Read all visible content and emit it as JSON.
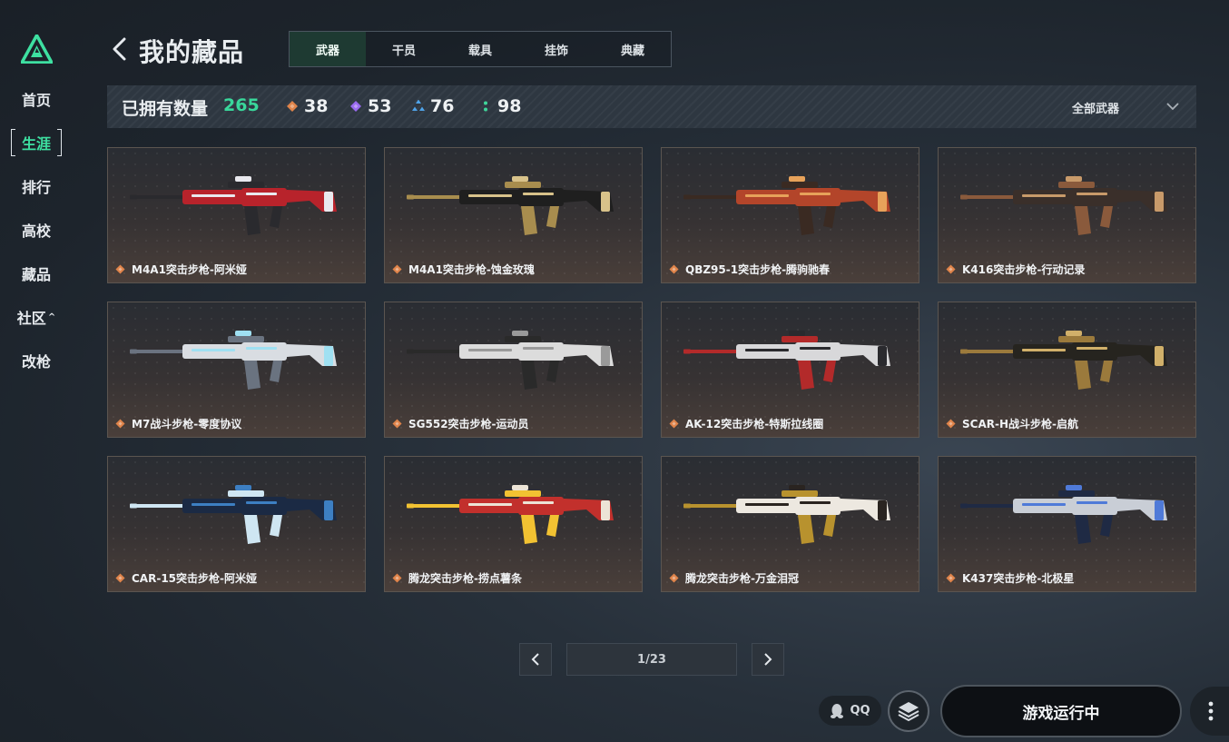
{
  "sidebar": {
    "nav": [
      {
        "label": "首页"
      },
      {
        "label": "生涯"
      },
      {
        "label": "排行"
      },
      {
        "label": "高校"
      },
      {
        "label": "藏品"
      },
      {
        "label": "社区"
      },
      {
        "label": "改枪"
      }
    ],
    "active_index": 1
  },
  "header": {
    "title": "我的藏品",
    "tabs": [
      {
        "label": "武器"
      },
      {
        "label": "干员"
      },
      {
        "label": "载具"
      },
      {
        "label": "挂饰"
      },
      {
        "label": "典藏"
      }
    ],
    "active_tab": 0
  },
  "stats": {
    "owned_label": "已拥有数量",
    "owned_count": "265",
    "rarities": [
      {
        "icon": "orange-diamond-icon",
        "color": "#e0844a",
        "count": "38"
      },
      {
        "icon": "purple-diamond-icon",
        "color": "#9a6bf0",
        "count": "53"
      },
      {
        "icon": "blue-triangle-icon",
        "color": "#4fa3e8",
        "count": "76"
      },
      {
        "icon": "green-dots-icon",
        "color": "#3fd69a",
        "count": "98"
      }
    ],
    "filter_label": "全部武器"
  },
  "grid": {
    "items": [
      {
        "name": "M4A1突击步枪-阿米娅",
        "rarity_color": "#e0844a",
        "palette": [
          "#b8232b",
          "#2a2a2e",
          "#e9e9ee"
        ]
      },
      {
        "name": "M4A1突击步枪-蚀金玫瑰",
        "rarity_color": "#e0844a",
        "palette": [
          "#1f1f1f",
          "#a88d4e",
          "#d8c28a"
        ]
      },
      {
        "name": "QBZ95-1突击步枪-腾驹驰春",
        "rarity_color": "#e0844a",
        "palette": [
          "#b3452a",
          "#3a2a22",
          "#e7a25a"
        ]
      },
      {
        "name": "K416突击步枪-行动记录",
        "rarity_color": "#e0844a",
        "palette": [
          "#3a2f2a",
          "#8a5a3c",
          "#c89a6a"
        ]
      },
      {
        "name": "M7战斗步枪-零度协议",
        "rarity_color": "#e0844a",
        "palette": [
          "#d9dde2",
          "#6a7380",
          "#9fe0f2"
        ]
      },
      {
        "name": "SG552突击步枪-运动员",
        "rarity_color": "#e0844a",
        "palette": [
          "#dcdcdc",
          "#2a2a2a",
          "#9a9a9a"
        ]
      },
      {
        "name": "AK-12突击步枪-特斯拉线圈",
        "rarity_color": "#e0844a",
        "palette": [
          "#d8d8da",
          "#b32a2a",
          "#2a2a2e"
        ]
      },
      {
        "name": "SCAR-H战斗步枪-启航",
        "rarity_color": "#e0844a",
        "palette": [
          "#26241f",
          "#9b7a3c",
          "#d1b06a"
        ]
      },
      {
        "name": "CAR-15突击步枪-阿米娅",
        "rarity_color": "#e0844a",
        "palette": [
          "#1b2a44",
          "#cfe6f2",
          "#3d7fc2"
        ]
      },
      {
        "name": "腾龙突击步枪-捞点薯条",
        "rarity_color": "#e0844a",
        "palette": [
          "#c2302c",
          "#f2c232",
          "#ece4d6"
        ]
      },
      {
        "name": "腾龙突击步枪-万金泪冠",
        "rarity_color": "#e0844a",
        "palette": [
          "#ede8e0",
          "#b8922e",
          "#2a2420"
        ]
      },
      {
        "name": "K437突击步枪-北极星",
        "rarity_color": "#e0844a",
        "palette": [
          "#c9ced6",
          "#1f2a44",
          "#4f7ad8"
        ]
      }
    ]
  },
  "pagination": {
    "label": "1/23"
  },
  "footer": {
    "qq_label": "QQ",
    "play_label": "游戏运行中"
  },
  "colors": {
    "accent": "#39d79b",
    "card_border": "#5b5550"
  }
}
